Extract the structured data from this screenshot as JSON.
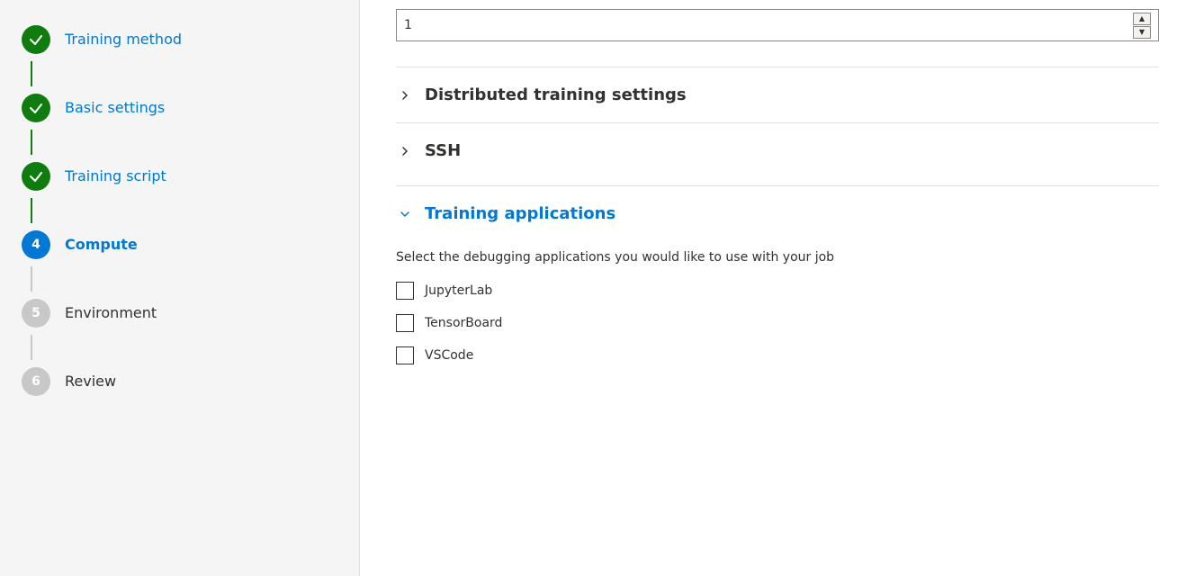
{
  "sidebar": {
    "steps": [
      {
        "id": "training-method",
        "label": "Training method",
        "state": "completed",
        "number": null,
        "has_connector": true,
        "connector_type": "green"
      },
      {
        "id": "basic-settings",
        "label": "Basic settings",
        "state": "completed",
        "number": null,
        "has_connector": true,
        "connector_type": "green"
      },
      {
        "id": "training-script",
        "label": "Training script",
        "state": "completed",
        "number": null,
        "has_connector": true,
        "connector_type": "green"
      },
      {
        "id": "compute",
        "label": "Compute",
        "state": "active",
        "number": "4",
        "has_connector": true,
        "connector_type": "gray"
      },
      {
        "id": "environment",
        "label": "Environment",
        "state": "inactive",
        "number": "5",
        "has_connector": true,
        "connector_type": "gray"
      },
      {
        "id": "review",
        "label": "Review",
        "state": "inactive",
        "number": "6",
        "has_connector": false,
        "connector_type": null
      }
    ]
  },
  "main": {
    "number_input_value": "1",
    "sections": [
      {
        "id": "distributed-training-settings",
        "title": "Distributed training settings",
        "expanded": false,
        "chevron": "right"
      },
      {
        "id": "ssh",
        "title": "SSH",
        "expanded": false,
        "chevron": "right"
      },
      {
        "id": "training-applications",
        "title": "Training applications",
        "expanded": true,
        "chevron": "down",
        "description": "Select the debugging applications you would like to use with your job",
        "checkboxes": [
          {
            "id": "jupyterlab",
            "label": "JupyterLab",
            "checked": false
          },
          {
            "id": "tensorboard",
            "label": "TensorBoard",
            "checked": false
          },
          {
            "id": "vscode",
            "label": "VSCode",
            "checked": false
          }
        ]
      }
    ]
  },
  "icons": {
    "checkmark": "✓",
    "chevron_right": "›",
    "chevron_down": "∨",
    "spinner_up": "▲",
    "spinner_down": "▼"
  }
}
